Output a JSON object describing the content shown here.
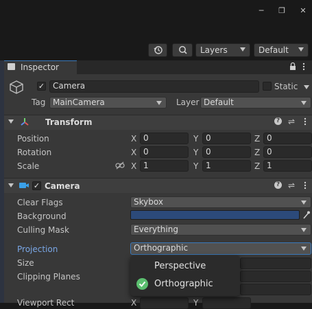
{
  "window": {
    "minimize": "─",
    "maximize": "❐",
    "close": "✕"
  },
  "toolbar": {
    "history_icon": "history-icon",
    "search_icon": "search-icon",
    "layers_label": "Layers",
    "layout_label": "Default"
  },
  "inspector_tab": {
    "label": "Inspector",
    "lock_icon": "lock-icon",
    "menu_icon": "kebab-icon"
  },
  "gameobject": {
    "active": true,
    "name": "Camera",
    "static_label": "Static",
    "static_checked": false,
    "tag_label": "Tag",
    "tag_value": "MainCamera",
    "layer_label": "Layer",
    "layer_value": "Default"
  },
  "transform": {
    "title": "Transform",
    "rows": [
      {
        "label": "Position",
        "x": "0",
        "y": "0",
        "z": "0"
      },
      {
        "label": "Rotation",
        "x": "0",
        "y": "0",
        "z": "0"
      },
      {
        "label": "Scale",
        "x": "1",
        "y": "1",
        "z": "1"
      }
    ],
    "axis": {
      "x": "X",
      "y": "Y",
      "z": "Z"
    }
  },
  "camera": {
    "title": "Camera",
    "enabled": true,
    "clear_flags_label": "Clear Flags",
    "clear_flags_value": "Skybox",
    "background_label": "Background",
    "background_color": "#2c4a7a",
    "culling_mask_label": "Culling Mask",
    "culling_mask_value": "Everything",
    "projection_label": "Projection",
    "projection_value": "Orthographic",
    "size_label": "Size",
    "clipping_label": "Clipping Planes",
    "viewport_label": "Viewport Rect",
    "viewport_axis_x": "X",
    "viewport_axis_y": "Y"
  },
  "projection_menu": {
    "options": [
      "Perspective",
      "Orthographic"
    ],
    "selected": "Orthographic",
    "check_color": "#5bbf6f"
  },
  "colors": {
    "accent_blue": "#3a79bb",
    "label_blue": "#7aa7e6"
  }
}
